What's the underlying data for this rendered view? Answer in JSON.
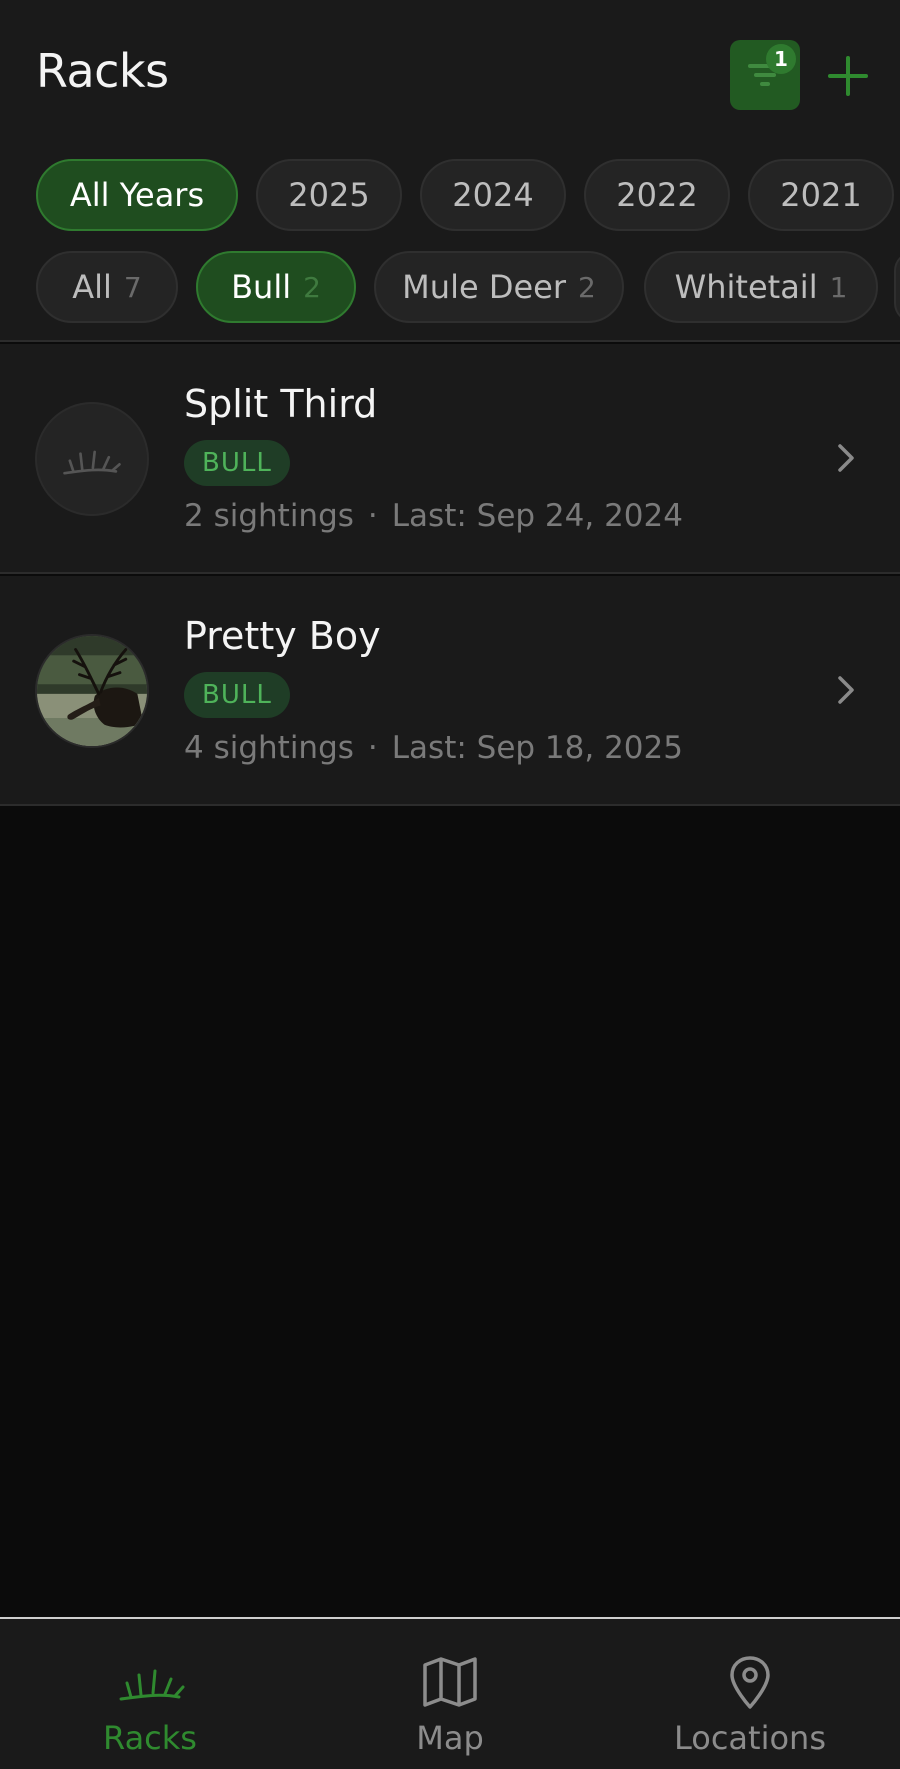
{
  "header": {
    "title": "Racks",
    "filter_badge_count": "1",
    "filter_icon": "filter-icon",
    "add_icon": "plus-icon"
  },
  "year_filters": [
    {
      "label": "All Years",
      "active": true
    },
    {
      "label": "2025",
      "active": false
    },
    {
      "label": "2024",
      "active": false
    },
    {
      "label": "2022",
      "active": false
    },
    {
      "label": "2021",
      "active": false
    }
  ],
  "species_filters": [
    {
      "label": "All",
      "count": "7",
      "active": false
    },
    {
      "label": "Bull",
      "count": "2",
      "active": true
    },
    {
      "label": "Mule Deer",
      "count": "2",
      "active": false
    },
    {
      "label": "Whitetail",
      "count": "1",
      "active": false
    }
  ],
  "racks": [
    {
      "name": "Split Third",
      "badge": "BULL",
      "sightings": "2 sightings",
      "separator": "·",
      "last": "Last: Sep 24, 2024",
      "avatar": "antler-placeholder-icon"
    },
    {
      "name": "Pretty Boy",
      "badge": "BULL",
      "sightings": "4 sightings",
      "separator": "·",
      "last": "Last: Sep 18, 2025",
      "avatar": "elk-photo"
    }
  ],
  "bottom_nav": [
    {
      "label": "Racks",
      "icon": "antler-icon",
      "active": true
    },
    {
      "label": "Map",
      "icon": "map-icon",
      "active": false
    },
    {
      "label": "Locations",
      "icon": "location-pin-icon",
      "active": false
    }
  ],
  "colors": {
    "accent": "#2f8a2f",
    "accent_dark": "#1f4d1f",
    "badge_bg": "#1f3d26",
    "badge_text": "#4fb35a",
    "surface": "#1a1a1a",
    "background": "#0b0b0b"
  }
}
